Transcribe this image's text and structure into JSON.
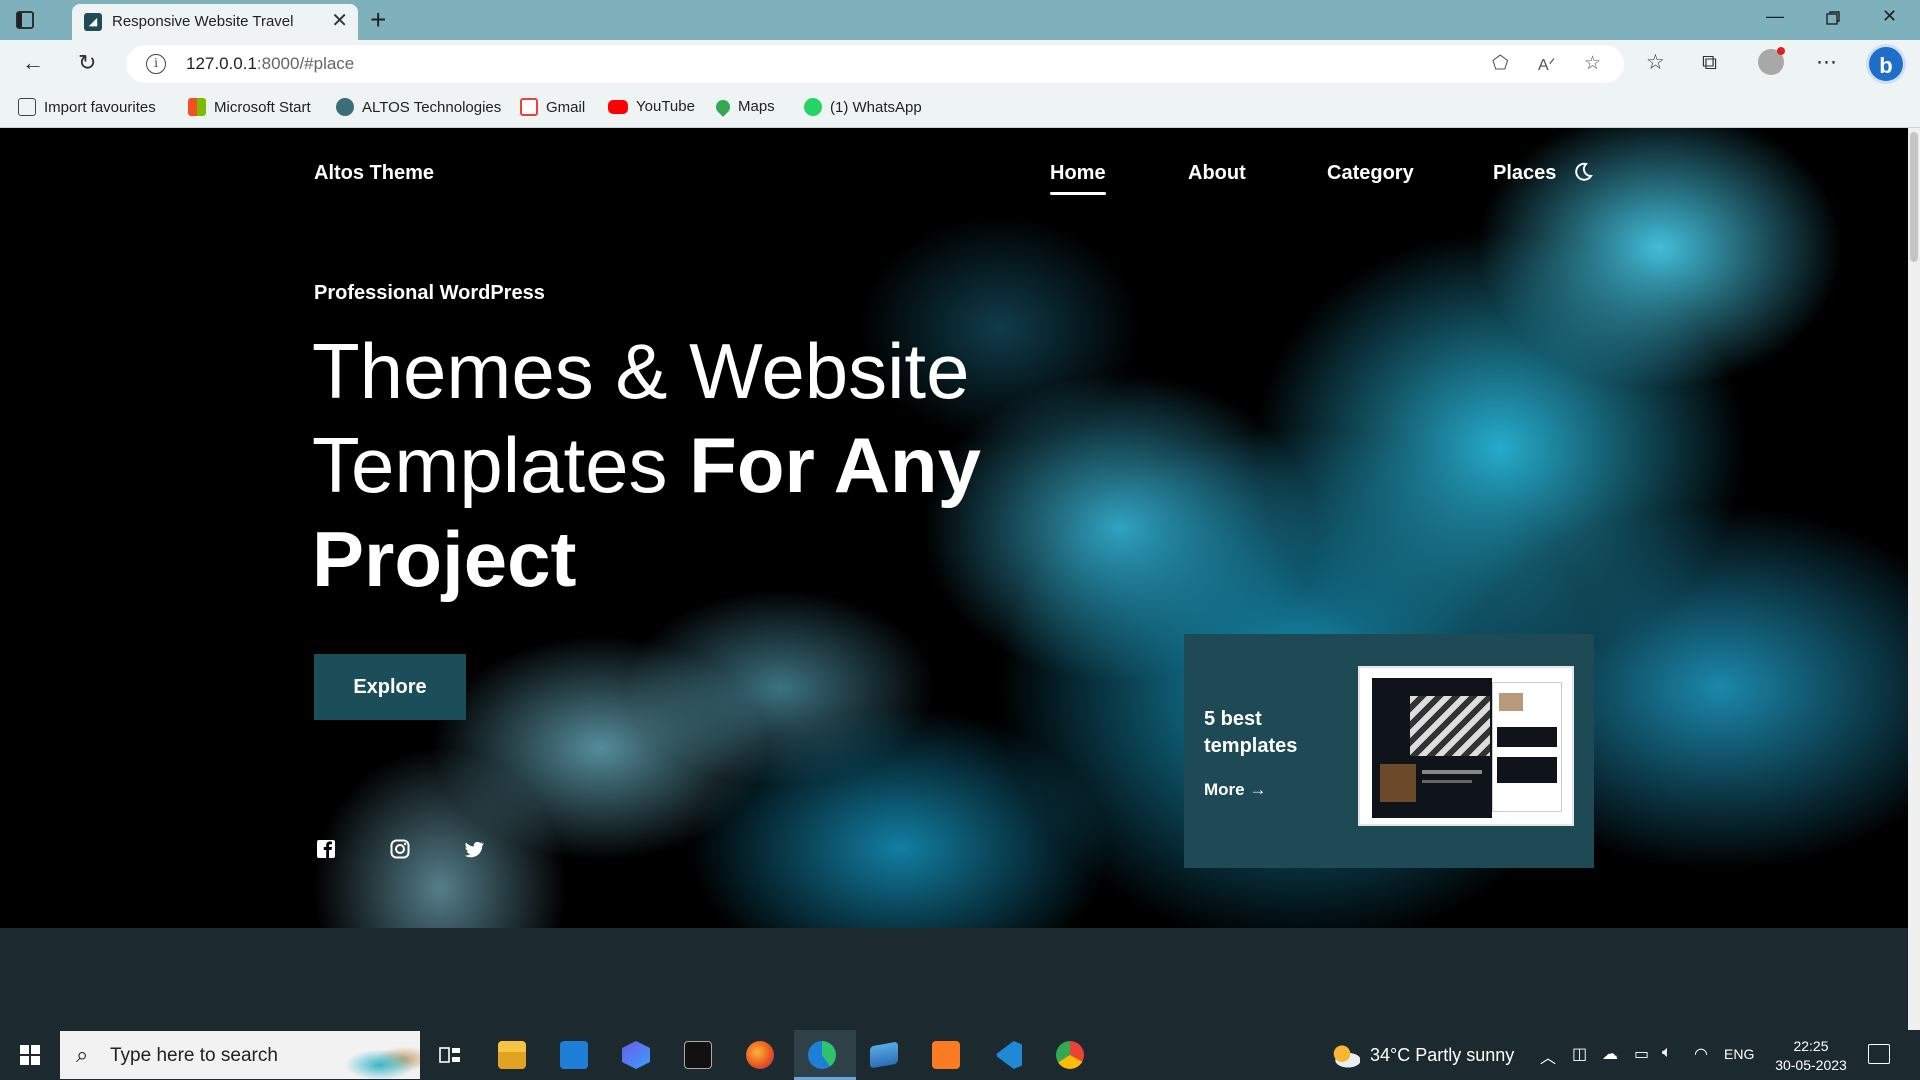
{
  "browser": {
    "tab_title": "Responsive Website Travel",
    "tab_close": "✕",
    "new_tab": "+",
    "url_host": "127.0.0.1",
    "url_rest": ":8000/#place",
    "info": "i",
    "favourites": [
      {
        "label": "Import favourites",
        "icon": "import-icon",
        "color": "#555555"
      },
      {
        "label": "Microsoft Start",
        "icon": "microsoft-icon",
        "color": "#f25022"
      },
      {
        "label": "ALTOS Technologies",
        "icon": "altos-icon",
        "color": "#3c6e7a"
      },
      {
        "label": "Gmail",
        "icon": "gmail-icon",
        "color": "#ea4335"
      },
      {
        "label": "YouTube",
        "icon": "youtube-icon",
        "color": "#ff0000"
      },
      {
        "label": "Maps",
        "icon": "maps-icon",
        "color": "#34a853"
      },
      {
        "label": "(1) WhatsApp",
        "icon": "whatsapp-icon",
        "color": "#25d366"
      }
    ]
  },
  "site": {
    "logo": "Altos Theme",
    "nav": [
      {
        "label": "Home",
        "active": true
      },
      {
        "label": "About",
        "active": false
      },
      {
        "label": "Category",
        "active": false
      },
      {
        "label": "Places",
        "active": false
      }
    ],
    "subtitle": "Professional WordPress",
    "headline_regular": "Themes & Website Templates ",
    "headline_bold": "For Any Project",
    "explore_label": "Explore",
    "card": {
      "title": "5 best templates",
      "more_label": "More",
      "more_arrow": "→"
    },
    "social": [
      "facebook-icon",
      "instagram-icon",
      "twitter-icon"
    ],
    "accent_color": "#1c4e5a"
  },
  "taskbar": {
    "search_placeholder": "Type here to search",
    "weather": "34°C  Partly sunny",
    "lang": "ENG",
    "time": "22:25",
    "date": "30-05-2023"
  }
}
